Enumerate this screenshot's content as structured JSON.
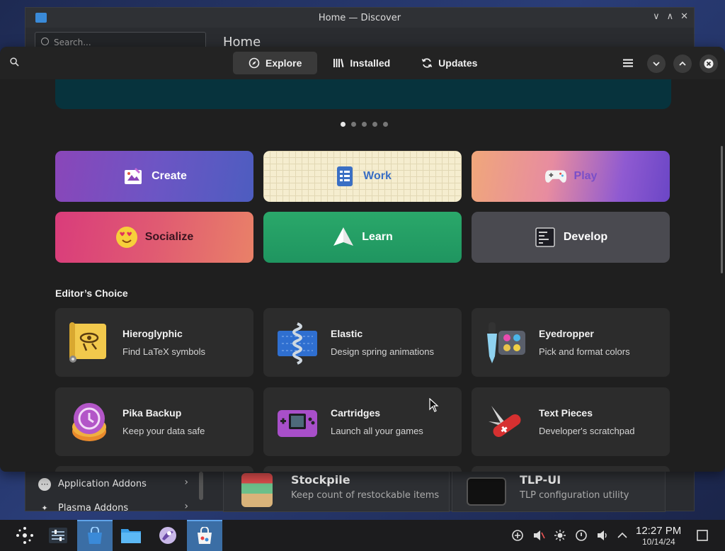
{
  "background_window": {
    "title": "Home — Discover",
    "search_placeholder": "Search...",
    "heading": "Home",
    "sidebar_items": [
      {
        "label": "Application Addons",
        "icon": "dots-icon"
      },
      {
        "label": "Plasma Addons",
        "icon": "plasma-icon"
      }
    ],
    "cards": [
      {
        "name": "Stockpile",
        "description": "Keep count of restockable items"
      },
      {
        "name": "TLP-UI",
        "description": "TLP configuration utility"
      }
    ]
  },
  "tabs": [
    {
      "label": "Explore",
      "icon": "compass-icon",
      "active": true
    },
    {
      "label": "Installed",
      "icon": "library-icon",
      "active": false
    },
    {
      "label": "Updates",
      "icon": "refresh-icon",
      "active": false
    }
  ],
  "carousel": {
    "count": 5,
    "active_index": 0
  },
  "categories": [
    {
      "label": "Create",
      "icon": "paint-icon",
      "text_color": "#ffffff"
    },
    {
      "label": "Work",
      "icon": "checklist-icon",
      "text_color": "#3a6fc4"
    },
    {
      "label": "Play",
      "icon": "gamepad-icon",
      "text_color": "#7a4fc8"
    },
    {
      "label": "Socialize",
      "icon": "heart-eyes-icon",
      "text_color": "#3a1420"
    },
    {
      "label": "Learn",
      "icon": "paper-plane-icon",
      "text_color": "#ffffff"
    },
    {
      "label": "Develop",
      "icon": "terminal-icon",
      "text_color": "#ffffff"
    }
  ],
  "editors_choice": {
    "title": "Editor’s Choice",
    "apps": [
      {
        "name": "Hieroglyphic",
        "description": "Find LaTeX symbols",
        "icon": "scroll-icon"
      },
      {
        "name": "Elastic",
        "description": "Design spring animations",
        "icon": "spring-icon"
      },
      {
        "name": "Eyedropper",
        "description": "Pick and format colors",
        "icon": "eyedropper-icon"
      },
      {
        "name": "Pika Backup",
        "description": "Keep your data safe",
        "icon": "backup-icon"
      },
      {
        "name": "Cartridges",
        "description": "Launch all your games",
        "icon": "handheld-console-icon"
      },
      {
        "name": "Text Pieces",
        "description": "Developer's scratchpad",
        "icon": "swiss-knife-icon"
      }
    ]
  },
  "taskbar": {
    "clock_time": "12:27 PM",
    "clock_date": "10/14/24"
  }
}
